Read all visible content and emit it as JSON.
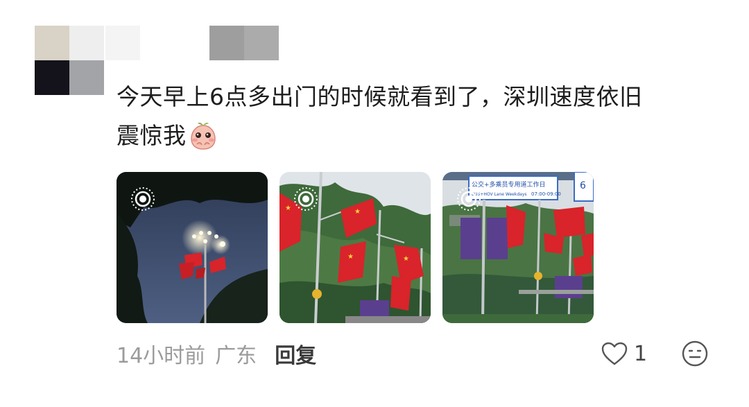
{
  "comment": {
    "text_line1": "今天早上6点多出门的时候就看到了，深圳速度依旧",
    "text_line2": "震惊我",
    "emoji_icon": "blushing-peach-emoji"
  },
  "photos": [
    {
      "icon": "live-photo-icon"
    },
    {
      "icon": "live-photo-icon"
    },
    {
      "icon": "live-photo-icon",
      "sign_text": "公交+多乘员专用道工作日",
      "sign_time": "07:00-09:00",
      "sign_sub": "BUS+HOV Lane Weekdays"
    }
  ],
  "meta": {
    "time": "14小时前",
    "location": "广东",
    "reply_label": "回复"
  },
  "actions": {
    "like_count": "1",
    "like_icon": "heart-icon",
    "emoji_icon": "emoji-icon"
  },
  "colors": {
    "text": "#1d1d1d",
    "meta": "#9b9b9b",
    "reply": "#3a3a3a",
    "flag_red": "#d8242a",
    "banner_purple": "#5b3f8f"
  }
}
